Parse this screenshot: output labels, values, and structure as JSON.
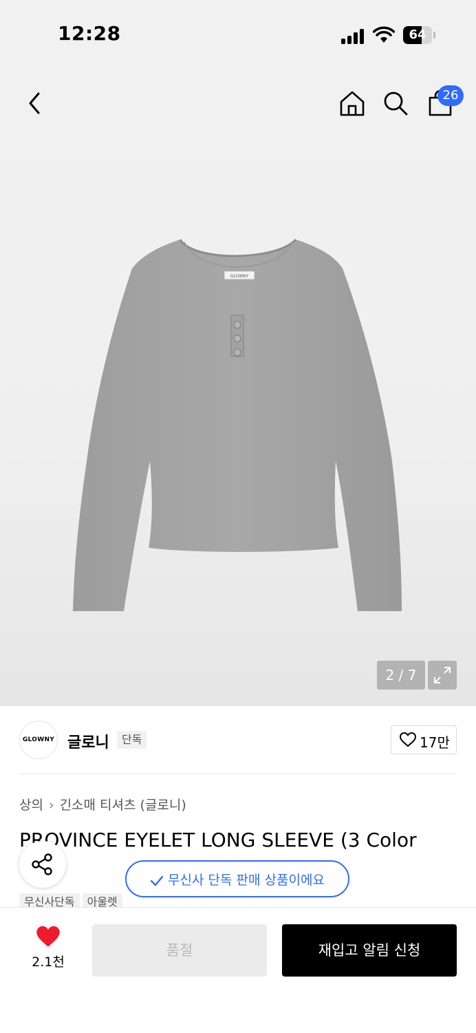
{
  "status_bar": {
    "time": "12:28",
    "battery": "64",
    "battery_level": 0.64
  },
  "header": {
    "back_icon": "chevron-left-icon",
    "home_icon": "home-icon",
    "search_icon": "search-icon",
    "cart_icon": "shopping-bag-icon",
    "cart_count": "26",
    "badge_color": "#2f6bff"
  },
  "gallery": {
    "shirt_label": "GLOWNY",
    "page_indicator": "2 / 7",
    "expand_icon": "expand-icon"
  },
  "brand": {
    "logo_text": "GLOWNY",
    "name": "글로니",
    "badge": "단독",
    "like_count": "17만"
  },
  "breadcrumb": {
    "category": "상의",
    "subcategory": "긴소매 티셔츠 (글로니)"
  },
  "product": {
    "title": "PROVINCE EYELET LONG SLEEVE (3 Color",
    "tags": [
      "무신사단독",
      "아울렛"
    ]
  },
  "toast": {
    "text": "무신사 단독 판매 상품이에요"
  },
  "bottom_bar": {
    "wish_count": "2.1천",
    "soldout_label": "품절",
    "restock_label": "재입고 알림 신청",
    "heart_color": "#ee1b2b"
  }
}
